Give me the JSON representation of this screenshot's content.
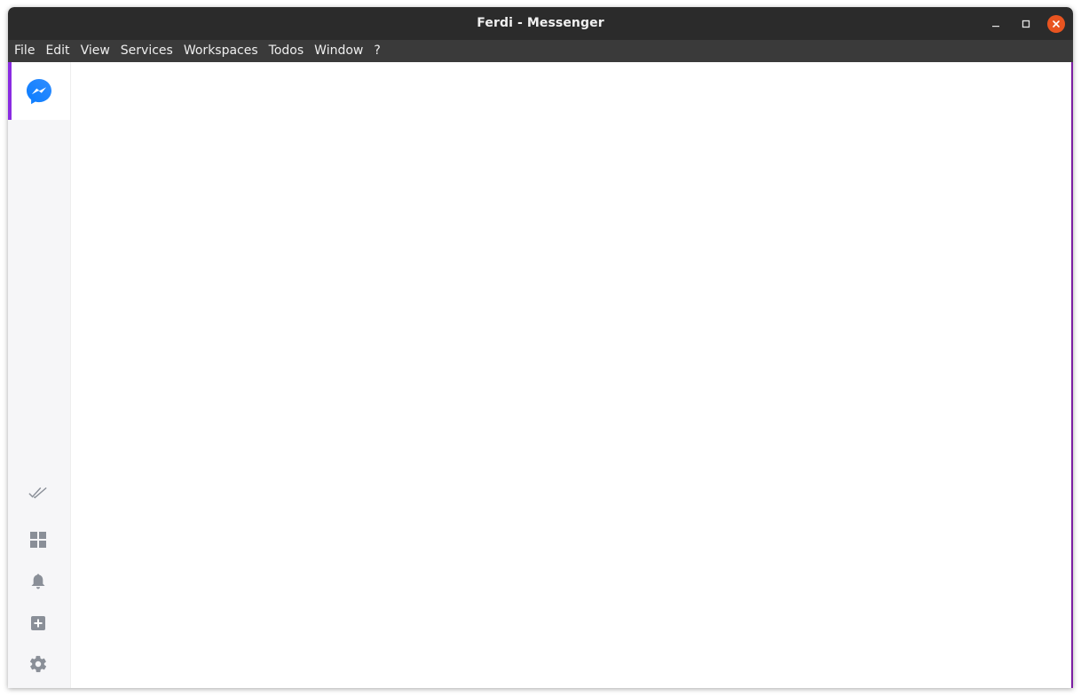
{
  "window": {
    "title": "Ferdi - Messenger"
  },
  "menubar": {
    "items": [
      "File",
      "Edit",
      "View",
      "Services",
      "Workspaces",
      "Todos",
      "Window",
      "?"
    ]
  },
  "sidebar": {
    "services": [
      {
        "icon": "messenger-icon",
        "active": true
      }
    ],
    "bottom_icons": [
      "todos-icon",
      "workspaces-icon",
      "notifications-icon",
      "add-service-icon",
      "settings-icon"
    ]
  },
  "colors": {
    "titlebar": "#2b2b2b",
    "menubar": "#3a3a3a",
    "accent": "#8a2be2",
    "close_button": "#e95420",
    "sidebar_bg": "#f6f6f8",
    "icon_gray": "#8a8f98"
  }
}
